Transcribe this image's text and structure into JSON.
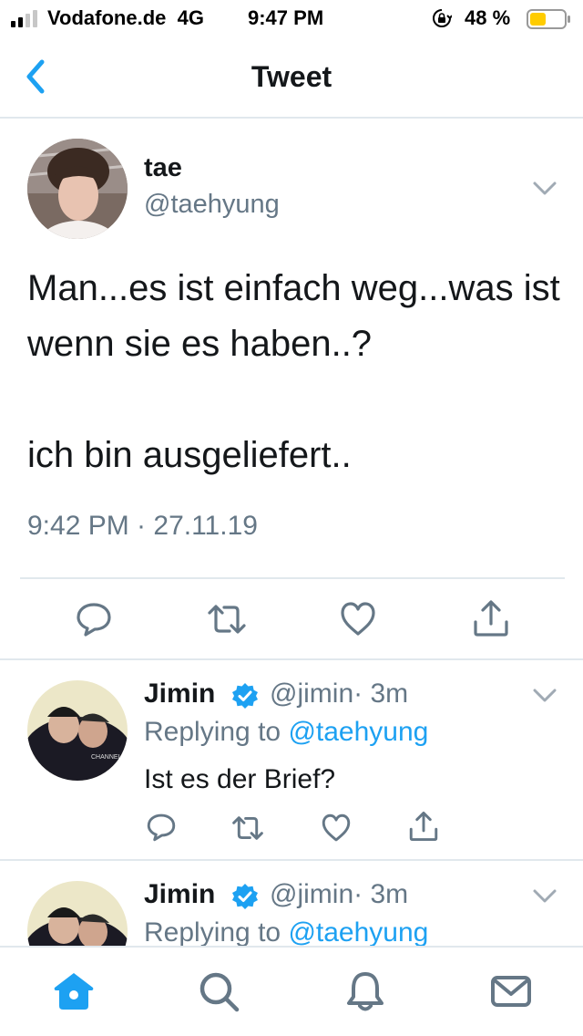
{
  "status_bar": {
    "carrier": "Vodafone.de",
    "network": "4G",
    "time": "9:47 PM",
    "battery_percent": "48 %",
    "battery_level": 0.48,
    "icons": [
      "signal-icon",
      "orientation-lock-icon",
      "battery-icon"
    ]
  },
  "nav": {
    "title": "Tweet",
    "back_icon": "chevron-left-icon"
  },
  "main_tweet": {
    "name": "tae",
    "handle": "@taehyung",
    "text": "Man...es ist einfach weg...was ist wenn sie es haben..?\n\nich bin ausgeliefert..",
    "timestamp": "9:42 PM · 27.11.19",
    "actions": [
      "reply-icon",
      "retweet-icon",
      "like-icon",
      "share-icon"
    ]
  },
  "replies": [
    {
      "name": "Jimin",
      "verified": true,
      "handle": "@jimin",
      "time": "· 3m",
      "replying_prefix": "Replying to ",
      "replying_to": "@taehyung",
      "text": "Ist es der Brief?"
    },
    {
      "name": "Jimin",
      "verified": true,
      "handle": "@jimin",
      "time": "· 3m",
      "replying_prefix": "Replying to ",
      "replying_to": "@taehyung",
      "text": ""
    }
  ],
  "tab_bar": {
    "tabs": [
      "home-icon",
      "search-icon",
      "notifications-icon",
      "messages-icon"
    ],
    "active": "home-icon"
  },
  "colors": {
    "accent": "#1da1f2",
    "text": "#14171a",
    "secondary": "#657786",
    "divider": "#e1e8ed",
    "battery_fill": "#ffcc00"
  }
}
